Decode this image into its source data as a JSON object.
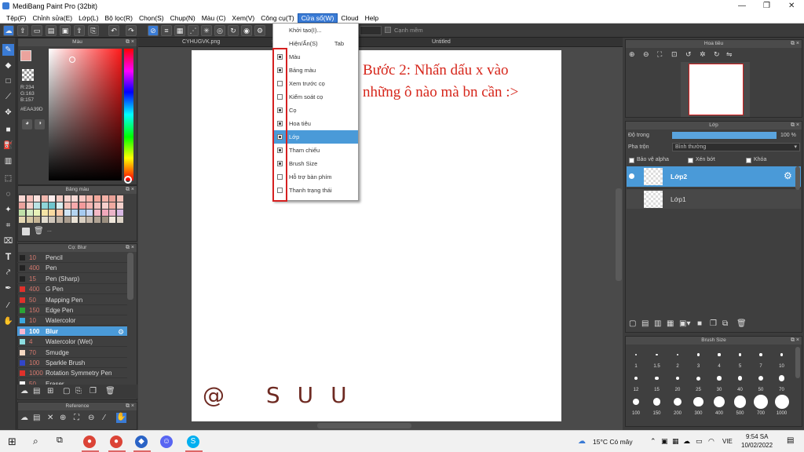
{
  "window": {
    "title": "MediBang Paint Pro (32bit)"
  },
  "menu": [
    "Tệp(F)",
    "Chỉnh sửa(E)",
    "Lớp(L)",
    "Bộ lọc(R)",
    "Chọn(S)",
    "Chụp(N)",
    "Màu (C)",
    "Xem(V)",
    "Công cụ(T)",
    "Cửa sổ(W)",
    "Cloud",
    "Help"
  ],
  "toolbar": {
    "antialias": "Cạnh mềm"
  },
  "tabs": {
    "doc1": "CYHUGVK.png",
    "doc2": "Untitled"
  },
  "color_panel": {
    "title": "Màu",
    "r": "R:234",
    "g": "G:163",
    "b": "B:157",
    "hex": "#EAA39D",
    "fg": "#EAA39D"
  },
  "palette_panel": {
    "title": "Bảng màu",
    "ellipsis": "..."
  },
  "brush_panel": {
    "title": "Cọ: Blur",
    "items": [
      {
        "size": "10",
        "name": "Pencil",
        "color": "#222222"
      },
      {
        "size": "400",
        "name": "Pen",
        "color": "#222222"
      },
      {
        "size": "15",
        "name": "Pen (Sharp)",
        "color": "#222222"
      },
      {
        "size": "400",
        "name": "G Pen",
        "color": "#e0312b"
      },
      {
        "size": "50",
        "name": "Mapping Pen",
        "color": "#e0312b"
      },
      {
        "size": "150",
        "name": "Edge Pen",
        "color": "#2aa436"
      },
      {
        "size": "10",
        "name": "Watercolor",
        "color": "#3aa7df"
      },
      {
        "size": "100",
        "name": "Blur",
        "color": "#f7b6d0"
      },
      {
        "size": "4",
        "name": "Watercolor (Wet)",
        "color": "#8cdde0"
      },
      {
        "size": "70",
        "name": "Smudge",
        "color": "#f4d8c2"
      },
      {
        "size": "100",
        "name": "Sparkle Brush",
        "color": "#3146c8"
      },
      {
        "size": "1000",
        "name": "Rotation Symmetry Pen",
        "color": "#e0312b"
      },
      {
        "size": "50",
        "name": "Eraser",
        "color": "#ffffff"
      }
    ]
  },
  "reference_panel": {
    "title": "Reference"
  },
  "dropdown": {
    "items": [
      {
        "label": "Khởi tạo(I)...",
        "check": false,
        "hascheck": false
      },
      {
        "label": "Hiện/Ẩn(S)",
        "extra": "Tab",
        "check": false,
        "hascheck": false
      },
      {
        "label": "Màu",
        "check": true,
        "hascheck": true
      },
      {
        "label": "Bảng màu",
        "check": true,
        "hascheck": true
      },
      {
        "label": "Xem trước cọ",
        "check": false,
        "hascheck": true
      },
      {
        "label": "Kiểm soát cọ",
        "check": false,
        "hascheck": true
      },
      {
        "label": "Cọ",
        "check": true,
        "hascheck": true
      },
      {
        "label": "Hoa tiêu",
        "check": true,
        "hascheck": true
      },
      {
        "label": "Lớp",
        "check": true,
        "hascheck": true,
        "highlight": true
      },
      {
        "label": "Tham chiếu",
        "check": true,
        "hascheck": true
      },
      {
        "label": "Brush Size",
        "check": true,
        "hascheck": true
      },
      {
        "label": "Hỗ trợ bàn phím",
        "check": false,
        "hascheck": true
      },
      {
        "label": "Thanh trạng thái",
        "check": false,
        "hascheck": true
      }
    ]
  },
  "annotation": {
    "line1": "Bước 2: Nhấn dấu x vào",
    "line2": "những ô nào mà bn cần :>"
  },
  "signature": "@ SUU",
  "navigator": {
    "title": "Hoa tiêu"
  },
  "layer_panel": {
    "title": "Lớp",
    "opacity_label": "Độ trong",
    "opacity_value": "100 %",
    "opacity": 1.0,
    "blend_label": "Pha trộn",
    "blend_value": "Bình thường",
    "protect_alpha": "Bảo vệ alpha",
    "clip": "Xén bớt",
    "lock": "Khóa",
    "layers": [
      {
        "name": "Lớp2",
        "selected": true
      },
      {
        "name": "Lớp1",
        "selected": false
      }
    ]
  },
  "brush_size_panel": {
    "title": "Brush Size",
    "sizes": [
      "1",
      "1.5",
      "2",
      "3",
      "4",
      "5",
      "7",
      "10",
      "12",
      "15",
      "20",
      "25",
      "30",
      "40",
      "50",
      "70",
      "100",
      "150",
      "200",
      "300",
      "400",
      "500",
      "700",
      "1000"
    ]
  },
  "taskbar": {
    "weather": "15°C Có mây",
    "lang": "VIE",
    "time": "9:54 SA",
    "date": "10/02/2022"
  }
}
